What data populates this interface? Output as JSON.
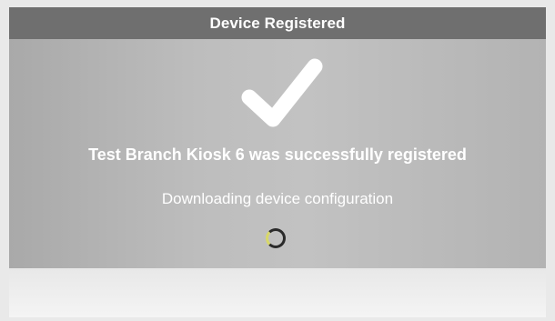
{
  "header": {
    "title": "Device Registered"
  },
  "main": {
    "success_icon": "checkmark-icon",
    "success_message": "Test Branch Kiosk 6 was successfully registered",
    "status_message": "Downloading device configuration",
    "progress_icon": "loading-spinner"
  },
  "colors": {
    "header_bg": "#6f6f6f",
    "content_bg": "#b5b5b5",
    "text": "#ffffff",
    "footer_bg": "#f0f0f0"
  }
}
